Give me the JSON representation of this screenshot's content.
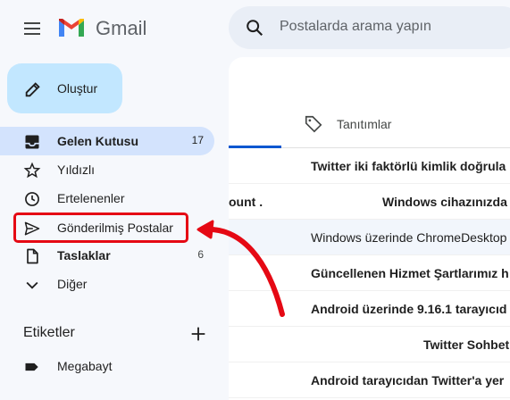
{
  "app": {
    "brand": "Gmail",
    "accent": "#0b57d0",
    "compose_color": "#c2e7ff",
    "active_color": "#d3e3fd",
    "annotation_color": "#e50914"
  },
  "search": {
    "placeholder": "Postalarda arama yapın"
  },
  "compose": {
    "label": "Oluştur",
    "icon": "pencil-icon"
  },
  "sidebar": {
    "items": [
      {
        "label": "Gelen Kutusu",
        "count": "17",
        "icon": "inbox-icon",
        "active": true
      },
      {
        "label": "Yıldızlı",
        "count": "",
        "icon": "star-icon"
      },
      {
        "label": "Ertelenenler",
        "count": "",
        "icon": "clock-icon"
      },
      {
        "label": "Gönderilmiş Postalar",
        "count": "",
        "icon": "send-icon"
      },
      {
        "label": "Taslaklar",
        "count": "6",
        "icon": "draft-icon"
      },
      {
        "label": "Diğer",
        "count": "",
        "icon": "chevron-down-icon"
      }
    ]
  },
  "labels": {
    "title": "Etiketler",
    "items": [
      {
        "label": "Megabayt",
        "icon": "label-icon"
      }
    ]
  },
  "tabs": [
    {
      "label": "Tanıtımlar",
      "icon": "tag-icon"
    }
  ],
  "emails": [
    {
      "text": "Twitter iki faktörlü kimlik doğrula",
      "unread": true
    },
    {
      "sender": "ount .",
      "text": "Windows cihazınızda",
      "unread": true
    },
    {
      "text": "Windows üzerinde ChromeDesktop",
      "unread": false
    },
    {
      "text": "Güncellenen Hizmet Şartlarımız h",
      "unread": true
    },
    {
      "text": "Android üzerinde 9.16.1 tarayıcıd",
      "unread": true
    },
    {
      "text": "Twitter Sohbet",
      "unread": true
    },
    {
      "text": "Android tarayıcıdan Twitter'a yer",
      "unread": true
    }
  ]
}
